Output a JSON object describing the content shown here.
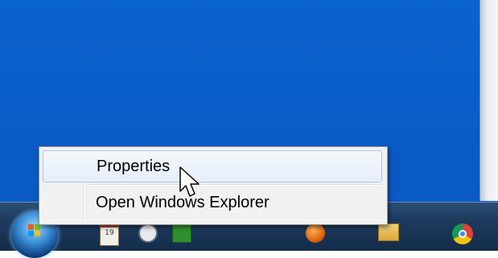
{
  "context_menu": {
    "items": [
      {
        "label": "Properties",
        "state": "hover"
      },
      {
        "label": "Open Windows Explorer",
        "state": "normal"
      }
    ]
  },
  "taskbar": {
    "icons": [
      "start-orb",
      "calendar-icon",
      "clock-icon",
      "green-app-icon",
      "orange-app-icon",
      "folder-icon",
      "chrome-icon"
    ],
    "calendar_text": "19"
  },
  "colors": {
    "desktop": "#0a5bc6",
    "menu_background": "#f1f1f1",
    "menu_hover_border": "#a9c7ee"
  }
}
